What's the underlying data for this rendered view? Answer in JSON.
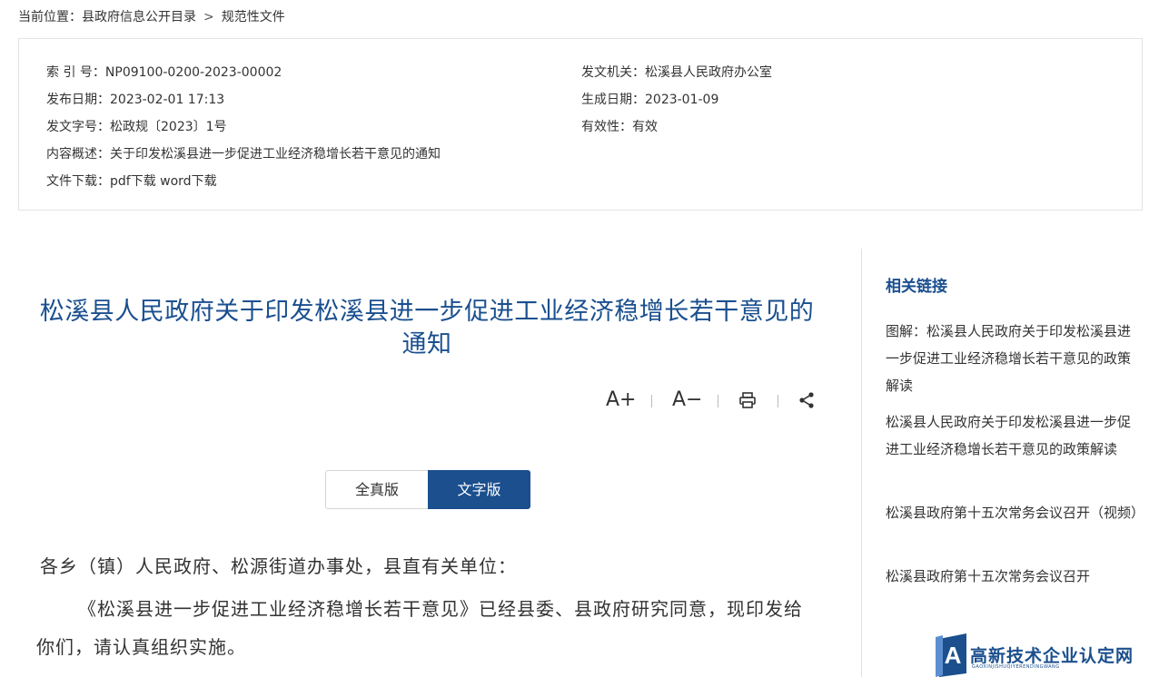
{
  "breadcrumb": {
    "label": "当前位置：",
    "items": [
      "县政府信息公开目录",
      "规范性文件"
    ],
    "separator": ">"
  },
  "meta": {
    "index_label": "索 引 号：",
    "index_value": "NP09100-0200-2023-00002",
    "issuer_label": "发文机关：",
    "issuer_value": "松溪县人民政府办公室",
    "publish_date_label": "发布日期：",
    "publish_date_value": "2023-02-01 17:13",
    "create_date_label": "生成日期：",
    "create_date_value": "2023-01-09",
    "doc_no_label": "发文字号：",
    "doc_no_value": "松政规〔2023〕1号",
    "validity_label": "有效性：",
    "validity_value": "有效",
    "summary_label": "内容概述：",
    "summary_value": "关于印发松溪县进一步促进工业经济稳增长若干意见的通知",
    "download_label": "文件下载：",
    "download_pdf": "pdf下载",
    "download_word": "word下载"
  },
  "article": {
    "title": "松溪县人民政府关于印发松溪县进一步促进工业经济稳增长若干意见的通知",
    "tools": {
      "font_increase": "A+",
      "font_decrease": "A−"
    },
    "version_full": "全真版",
    "version_text": "文字版",
    "salutation": "各乡（镇）人民政府、松源街道办事处，县直有关单位：",
    "paragraph1": "《松溪县进一步促进工业经济稳增长若干意见》已经县委、县政府研究同意，现印发给你们，请认真组织实施。"
  },
  "sidebar": {
    "title": "相关链接",
    "links": [
      "图解：松溪县人民政府关于印发松溪县进一步促进工业经济稳增长若干意见的政策解读",
      "松溪县人民政府关于印发松溪县进一步促进工业经济稳增长若干意见的政策解读",
      "松溪县政府第十五次常务会议召开（视频）",
      "松溪县政府第十五次常务会议召开"
    ]
  },
  "watermark": {
    "letter": "A",
    "text": "高新技术企业认定网",
    "subtext": "GAOXINJISHUQIYERENDINGWANG"
  },
  "colors": {
    "accent": "#1a4f8f",
    "button_active": "#1b4f8d",
    "border": "#e3e3e3"
  },
  "icons": [
    "print-icon",
    "share-icon"
  ]
}
